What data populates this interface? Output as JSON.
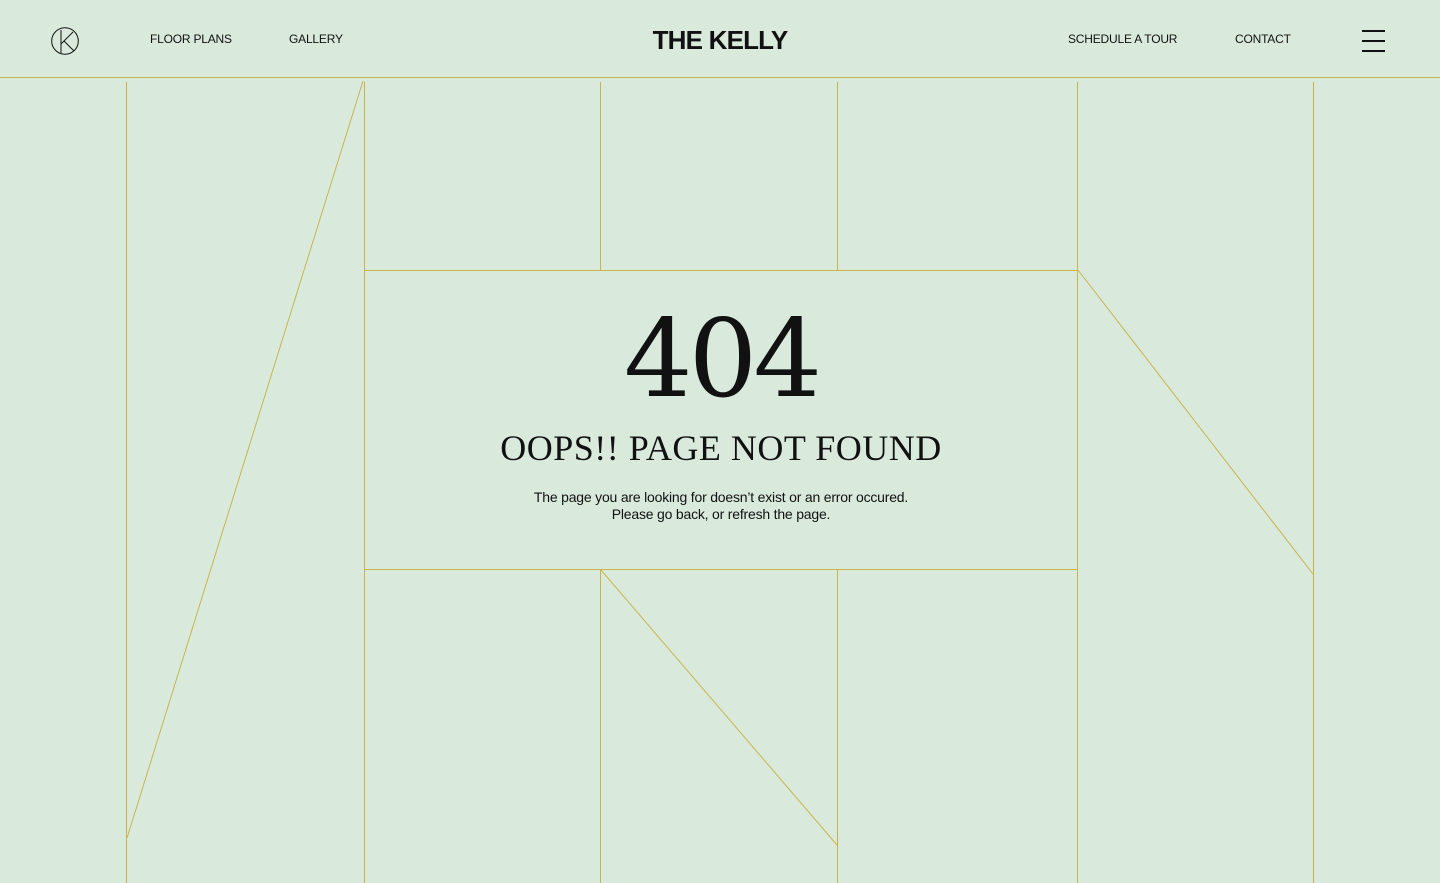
{
  "header": {
    "logo_icon": "k-circle-logo-icon",
    "brand": "THE KELLY",
    "nav_left": [
      "FLOOR PLANS",
      "GALLERY"
    ],
    "nav_right": [
      "SCHEDULE A TOUR",
      "CONTACT"
    ],
    "menu_icon": "hamburger-menu-icon"
  },
  "error": {
    "code": "404",
    "title": "OOPS!! PAGE NOT FOUND",
    "message_line1": "The page you are looking for doesn’t exist or an error occured.",
    "message_line2": "Please go back, or refresh the page."
  },
  "colors": {
    "background": "#d9eadd",
    "line": "#c9b44a",
    "text": "#111111"
  }
}
